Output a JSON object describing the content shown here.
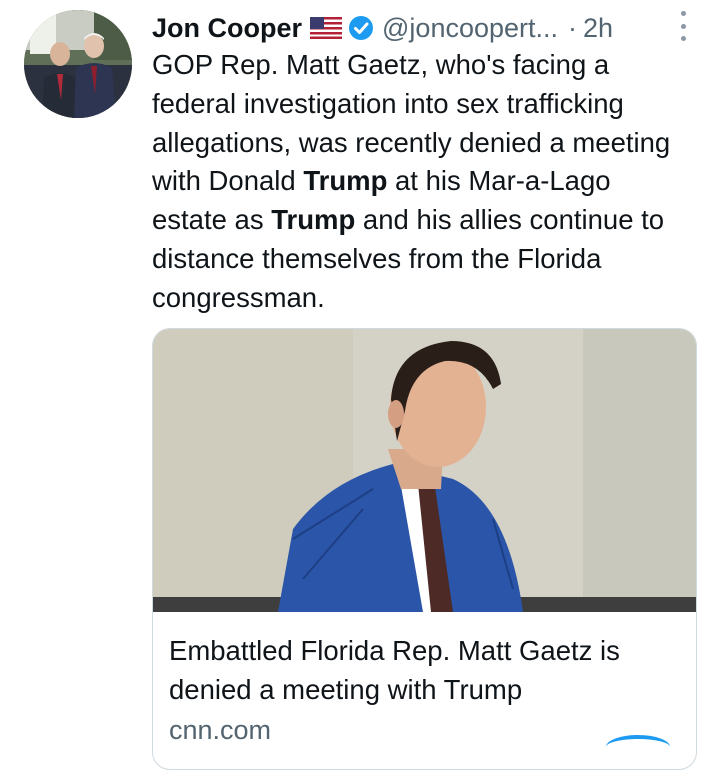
{
  "author": {
    "name": "Jon Cooper",
    "handle": "@joncoopert...",
    "separator": "·",
    "time": "2h"
  },
  "tweet": {
    "segments": [
      {
        "text": "GOP Rep. Matt Gaetz, who's facing a federal investigation into sex trafficking allegations, was recently denied a meeting with Donald ",
        "bold": false
      },
      {
        "text": "Trump",
        "bold": true
      },
      {
        "text": " at his Mar-a-Lago estate as ",
        "bold": false
      },
      {
        "text": "Trump",
        "bold": true
      },
      {
        "text": " and his allies continue to distance themselves from the Florida congressman.",
        "bold": false
      }
    ]
  },
  "card": {
    "title": "Embattled Florida Rep. Matt Gaetz is denied a meeting with Trump",
    "domain": "cnn.com"
  },
  "icons": {
    "flag": "us-flag-icon",
    "verified": "verified-badge-icon",
    "more": "more-options-icon"
  },
  "colors": {
    "text": "#0f1419",
    "secondary": "#536471",
    "verified": "#1d9bf0",
    "suit": "#2b55a8"
  }
}
